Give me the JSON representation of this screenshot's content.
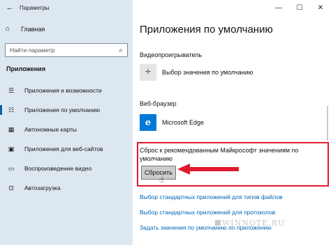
{
  "window": {
    "title": "Параметры",
    "back_icon": "←",
    "minimize": "—",
    "maximize": "☐",
    "close": "✕"
  },
  "sidebar": {
    "home_label": "Главная",
    "search_placeholder": "Найти параметр",
    "section": "Приложения",
    "items": [
      {
        "label": "Приложения и возможности",
        "icon": "apps-list-icon",
        "active": false
      },
      {
        "label": "Приложения по умолчанию",
        "icon": "default-apps-icon",
        "active": true
      },
      {
        "label": "Автономные карты",
        "icon": "offline-maps-icon",
        "active": false
      },
      {
        "label": "Приложения для веб-сайтов",
        "icon": "websites-apps-icon",
        "active": false
      },
      {
        "label": "Воспроизведение видео",
        "icon": "video-playback-icon",
        "active": false
      },
      {
        "label": "Автозагрузка",
        "icon": "startup-icon",
        "active": false
      }
    ]
  },
  "main": {
    "title": "Приложения по умолчанию",
    "video_label": "Видеопроигрыватель",
    "video_app": "Выбор значения по умолчанию",
    "browser_label": "Веб-браузер",
    "browser_app": "Microsoft Edge",
    "reset_text": "Сброс к рекомендованным Майкрософт значениям по умолчанию",
    "reset_button": "Сбросить",
    "links": [
      "Выбор стандартных приложений для типов файлов",
      "Выбор стандартных приложений для протоколов",
      "Задать значения по умолчанию по приложению"
    ],
    "watermark": "WINNOTE.RU"
  },
  "colors": {
    "sidebar_bg": "#dde7f0",
    "accent": "#0063b1",
    "highlight_red": "#e0192d"
  }
}
